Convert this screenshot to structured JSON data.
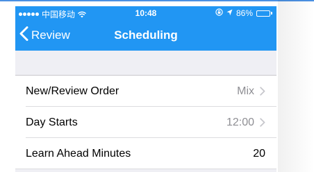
{
  "status_bar": {
    "carrier": "中国移动",
    "time": "10:48",
    "battery_text": "86%",
    "battery_level": 0.86,
    "signal_dots": 5,
    "icons": [
      "signal-dots-icon",
      "wifi-icon",
      "lock-rotation-icon",
      "location-arrow-icon",
      "battery-icon"
    ]
  },
  "nav": {
    "back_label": "Review",
    "title": "Scheduling",
    "back_icon": "chevron-left-icon"
  },
  "colors": {
    "accent": "#2196f3",
    "background": "#efeff4",
    "secondary_text": "#8e8e93",
    "separator": "#dcdcdf"
  },
  "settings": [
    {
      "label": "New/Review Order",
      "value": "Mix",
      "has_chevron": true
    },
    {
      "label": "Day Starts",
      "value": "12:00",
      "has_chevron": true
    },
    {
      "label": "Learn Ahead Minutes",
      "value": "20",
      "has_chevron": false
    }
  ]
}
